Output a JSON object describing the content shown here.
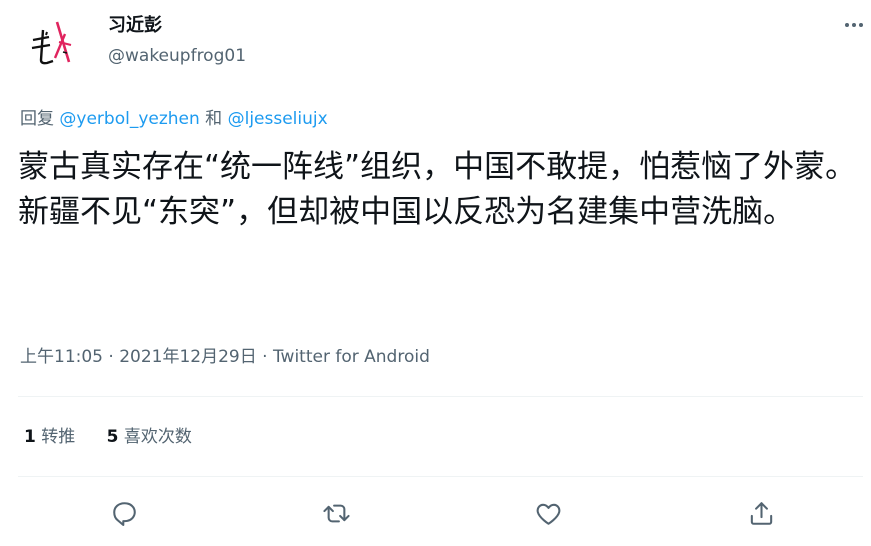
{
  "user": {
    "display_name": "习近彭",
    "handle": "@wakeupfrog01"
  },
  "reply": {
    "prefix": "回复 ",
    "mention1": "@yerbol_yezhen",
    "conj": " 和 ",
    "mention2": "@ljesseliujx"
  },
  "tweet": {
    "text": "蒙古真实存在“统一阵线”组织，中国不敢提，怕惹恼了外蒙。\n新疆不见“东突”，但却被中国以反恐为名建集中营洗脑。"
  },
  "meta": {
    "time": "上午11:05",
    "sep1": " · ",
    "date": "2021年12月29日",
    "sep2": " · ",
    "source": "Twitter for Android"
  },
  "stats": {
    "retweets_count": "1",
    "retweets_label": "转推",
    "likes_count": "5",
    "likes_label": "喜欢次数"
  },
  "icons": {
    "more": "more-horizontal-icon",
    "reply": "reply-icon",
    "retweet": "retweet-icon",
    "like": "like-icon",
    "share": "share-icon"
  },
  "colors": {
    "link": "#1d9bf0",
    "secondary": "#536471",
    "text": "#0f1419",
    "avatar_accent": "#e0245e"
  }
}
